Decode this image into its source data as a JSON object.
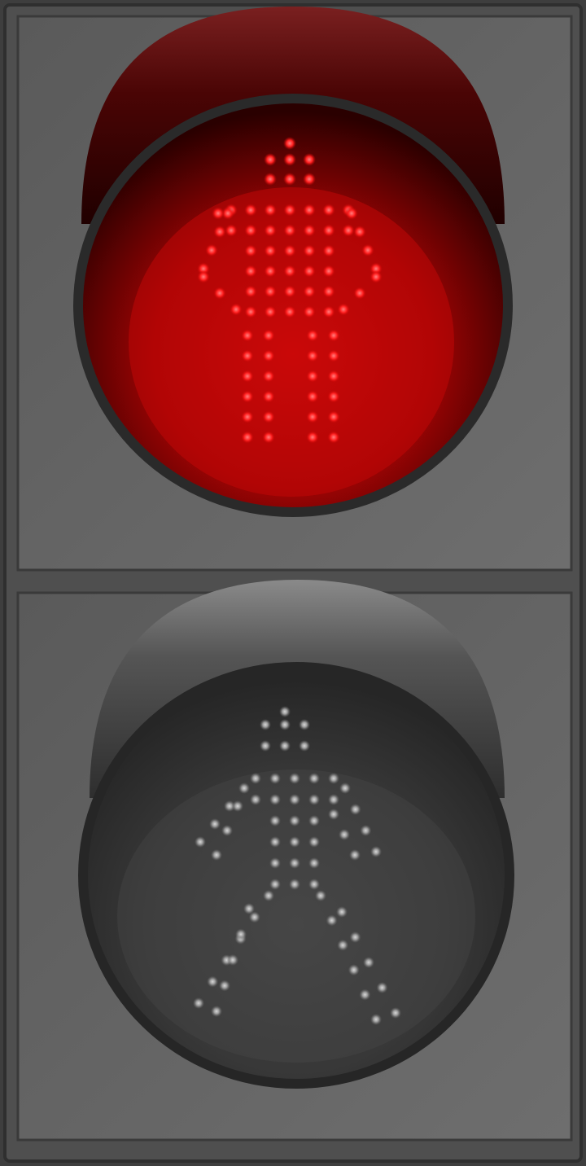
{
  "signal": {
    "active_state": "stop",
    "colors": {
      "housing": "#4f4f4f",
      "housing_edge": "#2f2f2f",
      "panel_light": "#6a6a6a",
      "panel_dark": "#525252",
      "lens_red": "#d30a0a",
      "lens_red_dark": "#3a0000",
      "led_red": "#ff2a2a",
      "lens_off": "#3b3b3b",
      "led_off": "#a8a8a8"
    },
    "lamps": [
      {
        "id": "stop",
        "icon": "standing-pedestrian-icon",
        "lit": true
      },
      {
        "id": "walk",
        "icon": "walking-pedestrian-icon",
        "lit": false
      }
    ]
  }
}
